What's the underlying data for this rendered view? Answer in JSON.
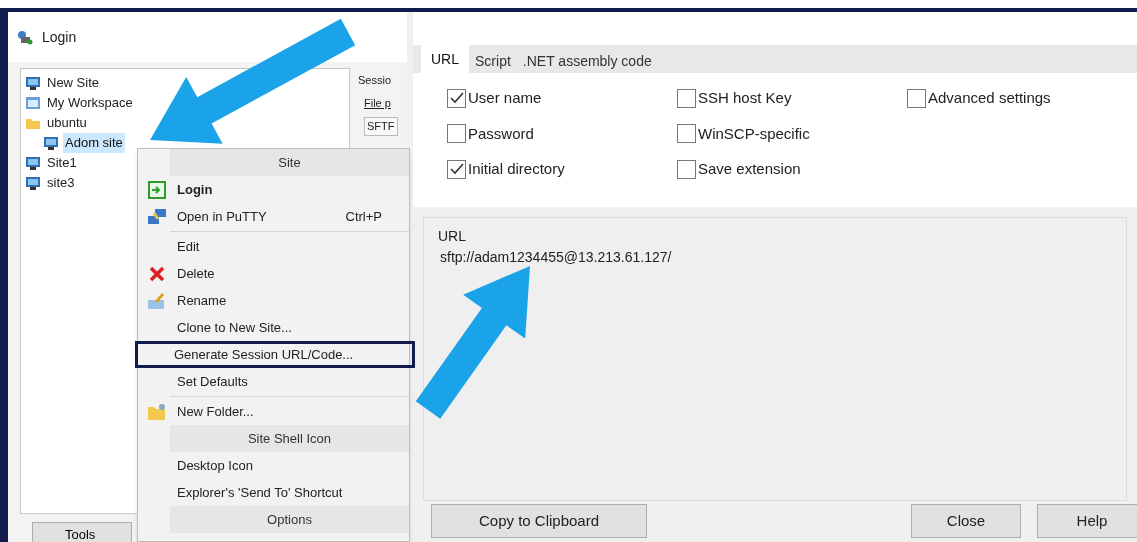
{
  "login_window": {
    "title": "Login",
    "site_tree": [
      {
        "label": "New Site",
        "kind": "site",
        "selected": false
      },
      {
        "label": "My Workspace",
        "kind": "workspace",
        "selected": false
      },
      {
        "label": "ubuntu",
        "kind": "folder",
        "selected": false,
        "children": [
          {
            "label": "Adom site",
            "kind": "site",
            "selected": true
          }
        ]
      },
      {
        "label": "Site1",
        "kind": "site",
        "selected": false
      },
      {
        "label": "site3",
        "kind": "site",
        "selected": false
      }
    ],
    "session_panel": {
      "heading": "Sessio",
      "label": "File p",
      "field_value": "SFTF"
    },
    "tools_button": "Tools"
  },
  "context_menu": {
    "items": [
      {
        "kind": "header",
        "label": "Site"
      },
      {
        "kind": "item",
        "label": "Login",
        "default": true,
        "outlined": false
      },
      {
        "kind": "item",
        "label": "Open in PuTTY",
        "shortcut": "Ctrl+P",
        "default": false,
        "outlined": false
      },
      {
        "kind": "separator"
      },
      {
        "kind": "item",
        "label": "Edit",
        "default": false,
        "outlined": false
      },
      {
        "kind": "item",
        "label": "Delete",
        "default": false,
        "outlined": false
      },
      {
        "kind": "item",
        "label": "Rename",
        "default": false,
        "outlined": false
      },
      {
        "kind": "item",
        "label": "Clone to New Site...",
        "default": false,
        "outlined": false
      },
      {
        "kind": "item",
        "label": "Generate Session URL/Code...",
        "default": false,
        "outlined": true
      },
      {
        "kind": "item",
        "label": "Set Defaults",
        "default": false,
        "outlined": false
      },
      {
        "kind": "separator"
      },
      {
        "kind": "item",
        "label": "New Folder...",
        "default": false,
        "outlined": false
      },
      {
        "kind": "header",
        "label": "Site Shell Icon"
      },
      {
        "kind": "item",
        "label": "Desktop Icon",
        "default": false,
        "outlined": false
      },
      {
        "kind": "item",
        "label": "Explorer's 'Send To' Shortcut",
        "default": false,
        "outlined": false
      },
      {
        "kind": "header",
        "label": "Options"
      }
    ]
  },
  "url_dialog": {
    "tabs": [
      {
        "label": "URL",
        "selected": true
      },
      {
        "label": "Script",
        "selected": false
      },
      {
        "label": ".NET assembly code",
        "selected": false
      }
    ],
    "options": [
      {
        "label": "User name",
        "checked": true
      },
      {
        "label": "Password",
        "checked": false
      },
      {
        "label": "Initial directory",
        "checked": true
      },
      {
        "label": "SSH host Key",
        "checked": false
      },
      {
        "label": "WinSCP-specific",
        "checked": false
      },
      {
        "label": "Save extension",
        "checked": false
      },
      {
        "label": "Advanced settings",
        "checked": false
      }
    ],
    "url_group": {
      "label": "URL",
      "value": "sftp://adam1234455@13.213.61.127/"
    },
    "buttons": [
      "Copy to Clipboard",
      "Close",
      "Help"
    ]
  }
}
